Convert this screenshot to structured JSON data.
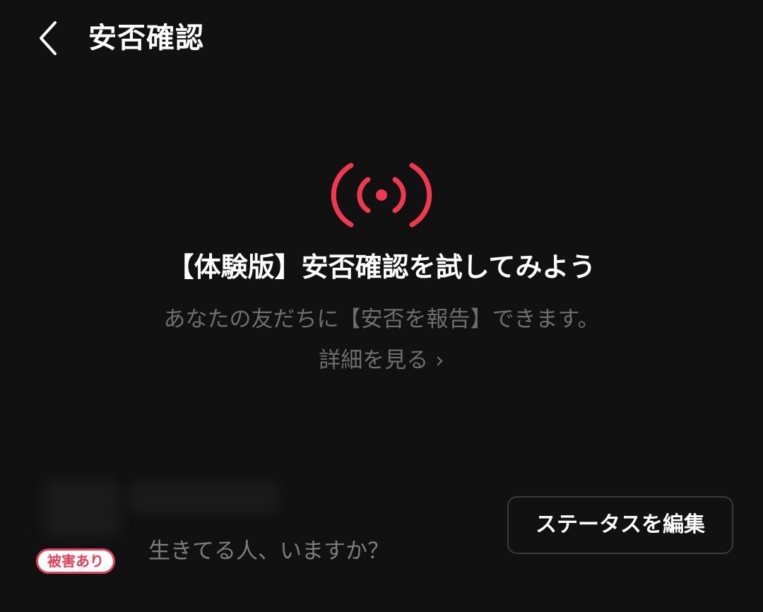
{
  "header": {
    "title": "安否確認",
    "back_icon": "chevron-left-icon"
  },
  "hero": {
    "icon": "broadcast-signal-icon",
    "icon_color": "#f0384f",
    "title": "【体験版】安否確認を試してみよう",
    "description": "あなたの友だちに【安否を報告】できます。",
    "details_link_label": "詳細を見る",
    "details_link_chevron": "›"
  },
  "status": {
    "badge_label": "被害あり",
    "badge_color": "#e8405a",
    "message": "生きてる人、いますか？",
    "edit_button_label": "ステータスを編集"
  }
}
